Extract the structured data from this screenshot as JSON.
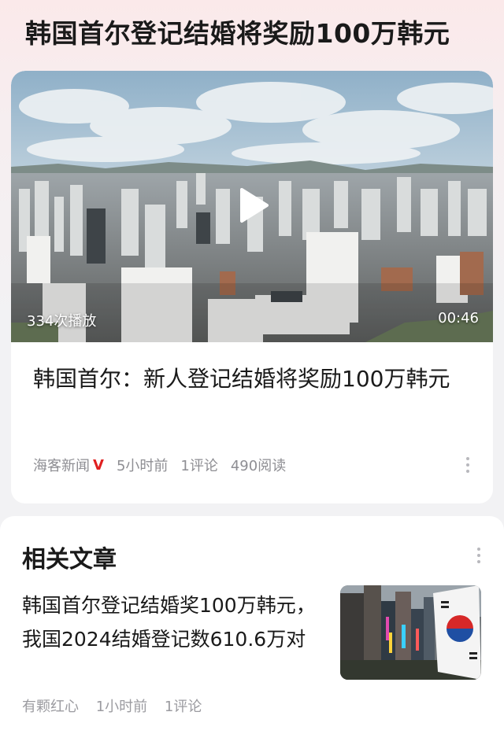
{
  "page": {
    "title": "韩国首尔登记结婚将奖励100万韩元"
  },
  "video_card": {
    "play_count": "334次播放",
    "duration": "00:46",
    "title": "韩国首尔：新人登记结婚将奖励100万韩元",
    "source": "海客新闻",
    "verified_badge": "V",
    "time": "5小时前",
    "comments": "1评论",
    "reads": "490阅读",
    "icons": [
      "play-icon",
      "more-icon"
    ]
  },
  "related": {
    "section_title": "相关文章",
    "articles": [
      {
        "title": "韩国首尔登记结婚奖100万韩元，我国2024结婚登记数610.6万对",
        "source": "有颗红心",
        "time": "1小时前",
        "comments": "1评论"
      }
    ]
  },
  "colors": {
    "accent_red": "#e02020",
    "meta_gray": "#8e8e93"
  }
}
